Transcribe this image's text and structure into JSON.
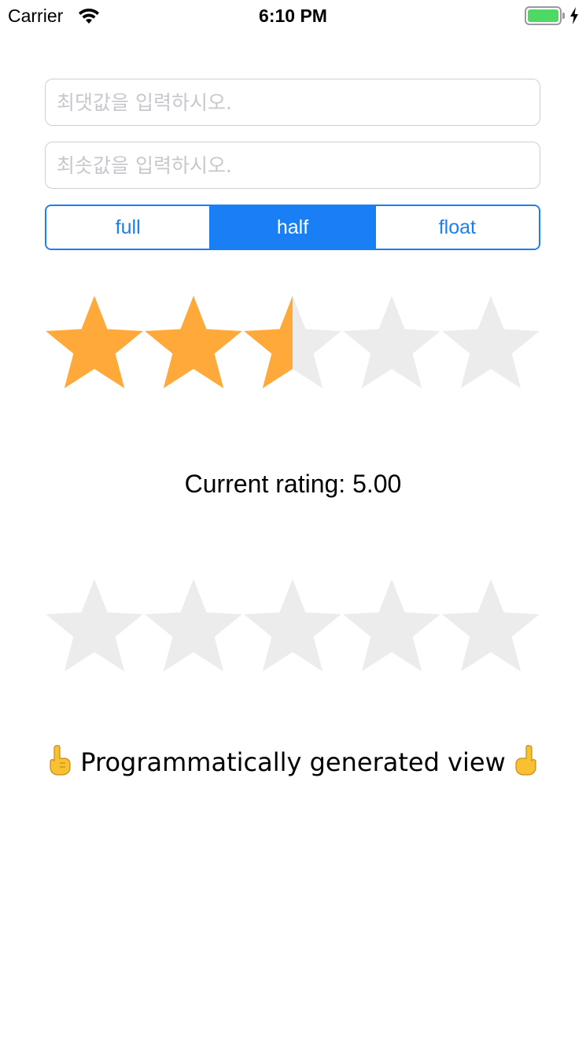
{
  "status_bar": {
    "carrier": "Carrier",
    "time": "6:10 PM",
    "icons": [
      "wifi-icon",
      "battery-icon",
      "charging-bolt-icon"
    ]
  },
  "form": {
    "max_placeholder": "최댓값을 입력하시오.",
    "min_placeholder": "최솟값을 입력하시오."
  },
  "segmented_control": {
    "segments": [
      "full",
      "half",
      "float"
    ],
    "selected": "half",
    "accent_color": "#1a7ef5"
  },
  "rating": {
    "stars_total": 5,
    "stars_filled": 2.5,
    "filled_color": "#ffa93a",
    "empty_color": "#ececec",
    "label": "Current rating: 5.00"
  },
  "generated_view": {
    "stars_total": 5,
    "stars_filled": 0,
    "label": "Programmatically generated view",
    "leading_icon": "pointing-up-hand-icon",
    "trailing_icon": "pointing-up-hand-icon"
  }
}
